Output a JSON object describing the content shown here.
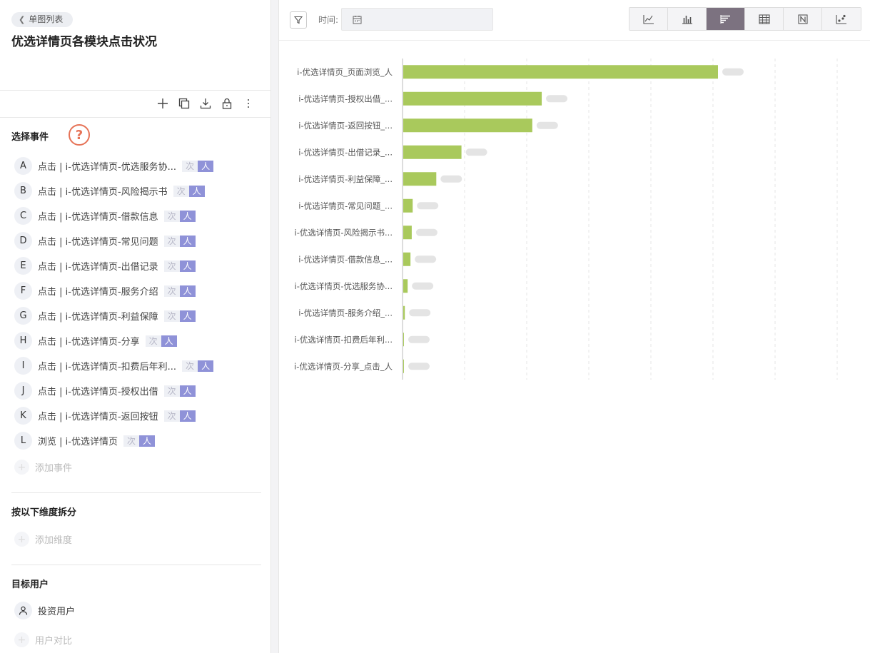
{
  "header": {
    "back_label": "单图列表",
    "title": "优选详情页各模块点击状况"
  },
  "toolbar": {
    "icons": [
      "plus-icon",
      "copy-icon",
      "download-icon",
      "lock-icon",
      "more-vertical-icon"
    ]
  },
  "events_section": {
    "title": "选择事件",
    "help_icon": "question-icon",
    "tag_ci": "次",
    "tag_ren": "人",
    "items": [
      {
        "letter": "A",
        "text": "点击 | i-优选详情页-优选服务协..."
      },
      {
        "letter": "B",
        "text": "点击 | i-优选详情页-风险揭示书"
      },
      {
        "letter": "C",
        "text": "点击 | i-优选详情页-借款信息"
      },
      {
        "letter": "D",
        "text": "点击 | i-优选详情页-常见问题"
      },
      {
        "letter": "E",
        "text": "点击 | i-优选详情页-出借记录"
      },
      {
        "letter": "F",
        "text": "点击 | i-优选详情页-服务介绍"
      },
      {
        "letter": "G",
        "text": "点击 | i-优选详情页-利益保障"
      },
      {
        "letter": "H",
        "text": "点击 | i-优选详情页-分享"
      },
      {
        "letter": "I",
        "text": "点击 | i-优选详情页-扣费后年利..."
      },
      {
        "letter": "J",
        "text": "点击 | i-优选详情页-授权出借"
      },
      {
        "letter": "K",
        "text": "点击 | i-优选详情页-返回按钮"
      },
      {
        "letter": "L",
        "text": "浏览 | i-优选详情页"
      }
    ],
    "add_label": "添加事件"
  },
  "dimension_section": {
    "title": "按以下维度拆分",
    "add_label": "添加维度"
  },
  "target_section": {
    "title": "目标用户",
    "user_label": "投资用户",
    "compare_label": "用户对比"
  },
  "filter_bar": {
    "time_label": "时间:",
    "chart_types": [
      "line-chart-icon",
      "column-chart-icon",
      "bar-chart-icon",
      "table-icon",
      "number-icon",
      "scatter-icon"
    ],
    "active_chart_type": 2
  },
  "colors": {
    "bar": "#a9c95c",
    "active_tab": "#7c7280",
    "tag_person": "#8f92d8",
    "help": "#e67357"
  },
  "chart_data": {
    "type": "bar",
    "orientation": "horizontal",
    "categories": [
      "i-优选详情页_页面浏览_人",
      "i-优选详情页-授权出借_...",
      "i-优选详情页-返回按钮_...",
      "i-优选详情页-出借记录_...",
      "i-优选详情页-利益保障_...",
      "i-优选详情页-常见问题_...",
      "i-优选详情页-风险揭示书...",
      "i-优选详情页-借款信息_...",
      "i-优选详情页-优选服务协...",
      "i-优选详情页-服务介绍_...",
      "i-优选详情页-扣费后年利...",
      "i-优选详情页-分享_点击_人"
    ],
    "values": [
      100,
      44,
      41,
      18.5,
      10.5,
      3,
      2.7,
      2.3,
      1.4,
      0.5,
      0.1,
      0.1
    ],
    "value_labels_blurred": true,
    "grid": true
  }
}
